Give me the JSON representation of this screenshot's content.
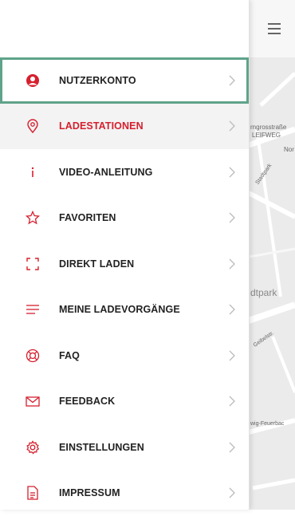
{
  "colors": {
    "accent": "#d5202e",
    "selection": "#5fa38a"
  },
  "menu": {
    "items": [
      {
        "label": "NUTZERKONTO",
        "icon": "user-circle-icon"
      },
      {
        "label": "LADESTATIONEN",
        "icon": "map-pin-icon"
      },
      {
        "label": "VIDEO-ANLEITUNG",
        "icon": "info-icon"
      },
      {
        "label": "FAVORITEN",
        "icon": "star-icon"
      },
      {
        "label": "DIREKT LADEN",
        "icon": "scan-frame-icon"
      },
      {
        "label": "MEINE LADEVORGÄNGE",
        "icon": "list-icon"
      },
      {
        "label": "FAQ",
        "icon": "lifebuoy-icon"
      },
      {
        "label": "FEEDBACK",
        "icon": "mail-icon"
      },
      {
        "label": "EINSTELLUNGEN",
        "icon": "gear-icon"
      },
      {
        "label": "IMPRESSUM",
        "icon": "document-icon"
      }
    ]
  },
  "map": {
    "labels": [
      "rngrosstraße",
      "LEIFWEG",
      "Nor",
      "Stadtpark",
      "dtpark",
      "Geibelstr.",
      "wig-Feuerbac"
    ]
  }
}
